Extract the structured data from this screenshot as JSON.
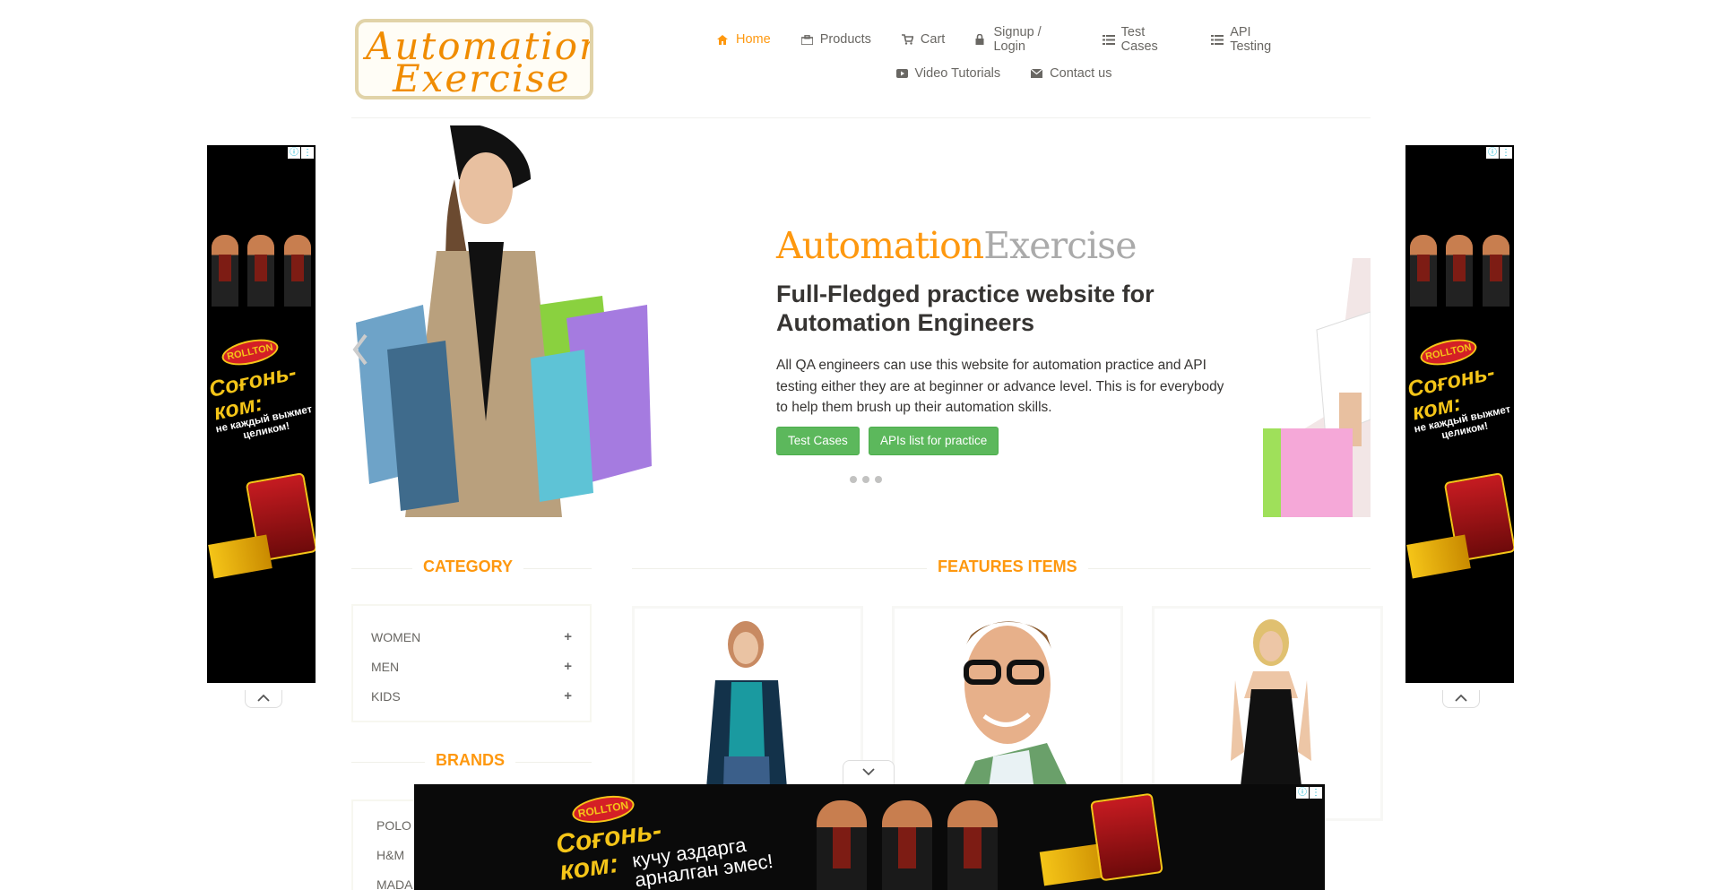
{
  "logo": {
    "line1": "Automation",
    "line2": "Exercise"
  },
  "nav": {
    "home": "Home",
    "products": "Products",
    "cart": "Cart",
    "signup": "Signup / Login",
    "test_cases": "Test Cases",
    "api_testing": "API Testing",
    "video": "Video Tutorials",
    "contact": "Contact us",
    "active_color": "#fe980f"
  },
  "slider": {
    "brand_a": "Automation",
    "brand_b": "Exercise",
    "title": "Full-Fledged practice website for Automation Engineers",
    "description": "All QA engineers can use this website for automation practice and API testing either they are at beginner or advance level. This is for everybody to help them brush up their automation skills.",
    "btn_test_cases": "Test Cases",
    "btn_apis": "APIs list for practice",
    "dot_count": 3
  },
  "category": {
    "title": "Category",
    "items": [
      {
        "label": "WOMEN"
      },
      {
        "label": "MEN"
      },
      {
        "label": "KIDS"
      }
    ]
  },
  "brands": {
    "title": "Brands",
    "items": [
      {
        "label": "POLO"
      },
      {
        "label": "H&M"
      },
      {
        "label": "MADA"
      }
    ]
  },
  "features": {
    "title": "Features Items"
  },
  "ads": {
    "brand": "ROLLTON",
    "slogan": "Соғонь-ком:",
    "side_sub": "не каждый выжмет целиком!",
    "bottom_sub": "кучу аздарга арналган эмес!"
  },
  "colors": {
    "accent": "#fe980f",
    "button_green": "#5cb85c"
  }
}
